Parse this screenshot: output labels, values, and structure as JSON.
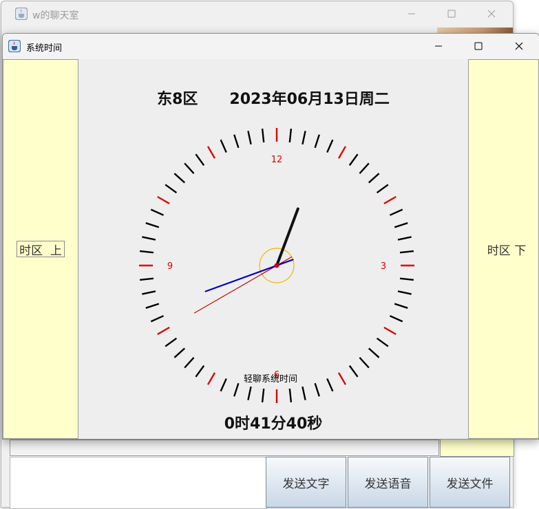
{
  "background_window": {
    "title": "w的聊天室",
    "buttons": [
      "发送文字",
      "发送语音",
      "发送文件"
    ]
  },
  "clock_window": {
    "title": "系统时间",
    "left_button": "时区  上",
    "right_button": "时区 下",
    "date_text": "东8区      2023年06月13日周二",
    "caption": "轻聊系统时间",
    "time_text": "0时41分40秒",
    "dial_numbers": {
      "n12": "12",
      "n3": "3",
      "n6": "6",
      "n9": "9"
    },
    "clock_time": {
      "hour": 0,
      "minute": 41,
      "second": 40
    }
  },
  "colors": {
    "panel_yellow": "#ffffcc",
    "tick_major": "#e00000",
    "tick_minor": "#000000",
    "hour_hand": "#111111",
    "minute_hand": "#0000cc",
    "second_hand": "#cc0000",
    "center_ring": "#f2b600"
  },
  "icons": [
    "java-app-icon",
    "minimize-icon",
    "maximize-icon",
    "close-icon"
  ]
}
